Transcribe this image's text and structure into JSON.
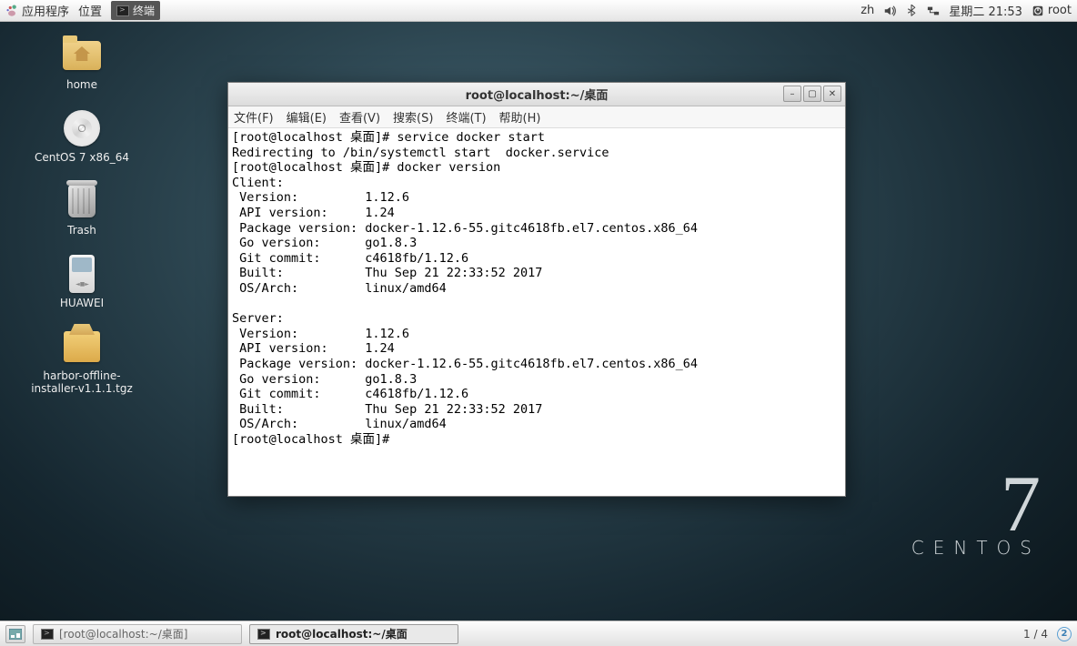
{
  "top_panel": {
    "applications": "应用程序",
    "places": "位置",
    "running_app": "终端",
    "lang": "zh",
    "datetime": "星期二  21:53",
    "user": "root"
  },
  "desktop_icons": [
    {
      "id": "home",
      "label": "home"
    },
    {
      "id": "disc",
      "label": "CentOS 7 x86_64"
    },
    {
      "id": "trash",
      "label": "Trash"
    },
    {
      "id": "ipod",
      "label": "HUAWEI"
    },
    {
      "id": "pkg",
      "label": "harbor-offline-\ninstaller-v1.1.1.tgz"
    }
  ],
  "window": {
    "title": "root@localhost:~/桌面",
    "menus": [
      "文件(F)",
      "编辑(E)",
      "查看(V)",
      "搜索(S)",
      "终端(T)",
      "帮助(H)"
    ],
    "terminal_lines": [
      "[root@localhost 桌面]# service docker start",
      "Redirecting to /bin/systemctl start  docker.service",
      "[root@localhost 桌面]# docker version",
      "Client:",
      " Version:         1.12.6",
      " API version:     1.24",
      " Package version: docker-1.12.6-55.gitc4618fb.el7.centos.x86_64",
      " Go version:      go1.8.3",
      " Git commit:      c4618fb/1.12.6",
      " Built:           Thu Sep 21 22:33:52 2017",
      " OS/Arch:         linux/amd64",
      "",
      "Server:",
      " Version:         1.12.6",
      " API version:     1.24",
      " Package version: docker-1.12.6-55.gitc4618fb.el7.centos.x86_64",
      " Go version:      go1.8.3",
      " Git commit:      c4618fb/1.12.6",
      " Built:           Thu Sep 21 22:33:52 2017",
      " OS/Arch:         linux/amd64",
      "[root@localhost 桌面]# "
    ]
  },
  "brand": {
    "seven": "7",
    "name": "CENTOS"
  },
  "bottom_panel": {
    "task_inactive": "[root@localhost:~/桌面]",
    "task_active": "root@localhost:~/桌面",
    "workspace": "1 / 4",
    "ws_badge": "2"
  }
}
